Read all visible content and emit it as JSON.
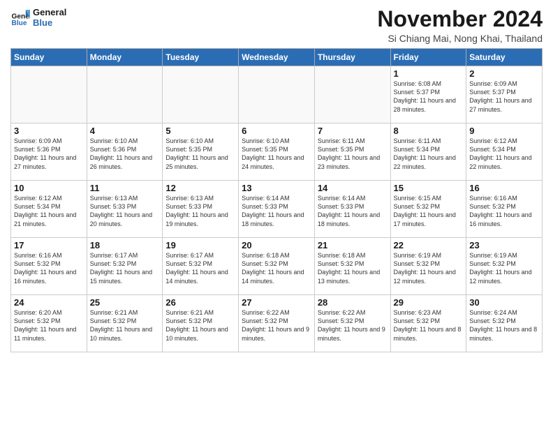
{
  "logo": {
    "line1": "General",
    "line2": "Blue"
  },
  "title": "November 2024",
  "location": "Si Chiang Mai, Nong Khai, Thailand",
  "days_of_week": [
    "Sunday",
    "Monday",
    "Tuesday",
    "Wednesday",
    "Thursday",
    "Friday",
    "Saturday"
  ],
  "weeks": [
    [
      {
        "day": "",
        "detail": ""
      },
      {
        "day": "",
        "detail": ""
      },
      {
        "day": "",
        "detail": ""
      },
      {
        "day": "",
        "detail": ""
      },
      {
        "day": "",
        "detail": ""
      },
      {
        "day": "1",
        "detail": "Sunrise: 6:08 AM\nSunset: 5:37 PM\nDaylight: 11 hours\nand 28 minutes."
      },
      {
        "day": "2",
        "detail": "Sunrise: 6:09 AM\nSunset: 5:37 PM\nDaylight: 11 hours\nand 27 minutes."
      }
    ],
    [
      {
        "day": "3",
        "detail": "Sunrise: 6:09 AM\nSunset: 5:36 PM\nDaylight: 11 hours\nand 27 minutes."
      },
      {
        "day": "4",
        "detail": "Sunrise: 6:10 AM\nSunset: 5:36 PM\nDaylight: 11 hours\nand 26 minutes."
      },
      {
        "day": "5",
        "detail": "Sunrise: 6:10 AM\nSunset: 5:35 PM\nDaylight: 11 hours\nand 25 minutes."
      },
      {
        "day": "6",
        "detail": "Sunrise: 6:10 AM\nSunset: 5:35 PM\nDaylight: 11 hours\nand 24 minutes."
      },
      {
        "day": "7",
        "detail": "Sunrise: 6:11 AM\nSunset: 5:35 PM\nDaylight: 11 hours\nand 23 minutes."
      },
      {
        "day": "8",
        "detail": "Sunrise: 6:11 AM\nSunset: 5:34 PM\nDaylight: 11 hours\nand 22 minutes."
      },
      {
        "day": "9",
        "detail": "Sunrise: 6:12 AM\nSunset: 5:34 PM\nDaylight: 11 hours\nand 22 minutes."
      }
    ],
    [
      {
        "day": "10",
        "detail": "Sunrise: 6:12 AM\nSunset: 5:34 PM\nDaylight: 11 hours\nand 21 minutes."
      },
      {
        "day": "11",
        "detail": "Sunrise: 6:13 AM\nSunset: 5:33 PM\nDaylight: 11 hours\nand 20 minutes."
      },
      {
        "day": "12",
        "detail": "Sunrise: 6:13 AM\nSunset: 5:33 PM\nDaylight: 11 hours\nand 19 minutes."
      },
      {
        "day": "13",
        "detail": "Sunrise: 6:14 AM\nSunset: 5:33 PM\nDaylight: 11 hours\nand 18 minutes."
      },
      {
        "day": "14",
        "detail": "Sunrise: 6:14 AM\nSunset: 5:33 PM\nDaylight: 11 hours\nand 18 minutes."
      },
      {
        "day": "15",
        "detail": "Sunrise: 6:15 AM\nSunset: 5:32 PM\nDaylight: 11 hours\nand 17 minutes."
      },
      {
        "day": "16",
        "detail": "Sunrise: 6:16 AM\nSunset: 5:32 PM\nDaylight: 11 hours\nand 16 minutes."
      }
    ],
    [
      {
        "day": "17",
        "detail": "Sunrise: 6:16 AM\nSunset: 5:32 PM\nDaylight: 11 hours\nand 16 minutes."
      },
      {
        "day": "18",
        "detail": "Sunrise: 6:17 AM\nSunset: 5:32 PM\nDaylight: 11 hours\nand 15 minutes."
      },
      {
        "day": "19",
        "detail": "Sunrise: 6:17 AM\nSunset: 5:32 PM\nDaylight: 11 hours\nand 14 minutes."
      },
      {
        "day": "20",
        "detail": "Sunrise: 6:18 AM\nSunset: 5:32 PM\nDaylight: 11 hours\nand 14 minutes."
      },
      {
        "day": "21",
        "detail": "Sunrise: 6:18 AM\nSunset: 5:32 PM\nDaylight: 11 hours\nand 13 minutes."
      },
      {
        "day": "22",
        "detail": "Sunrise: 6:19 AM\nSunset: 5:32 PM\nDaylight: 11 hours\nand 12 minutes."
      },
      {
        "day": "23",
        "detail": "Sunrise: 6:19 AM\nSunset: 5:32 PM\nDaylight: 11 hours\nand 12 minutes."
      }
    ],
    [
      {
        "day": "24",
        "detail": "Sunrise: 6:20 AM\nSunset: 5:32 PM\nDaylight: 11 hours\nand 11 minutes."
      },
      {
        "day": "25",
        "detail": "Sunrise: 6:21 AM\nSunset: 5:32 PM\nDaylight: 11 hours\nand 10 minutes."
      },
      {
        "day": "26",
        "detail": "Sunrise: 6:21 AM\nSunset: 5:32 PM\nDaylight: 11 hours\nand 10 minutes."
      },
      {
        "day": "27",
        "detail": "Sunrise: 6:22 AM\nSunset: 5:32 PM\nDaylight: 11 hours\nand 9 minutes."
      },
      {
        "day": "28",
        "detail": "Sunrise: 6:22 AM\nSunset: 5:32 PM\nDaylight: 11 hours\nand 9 minutes."
      },
      {
        "day": "29",
        "detail": "Sunrise: 6:23 AM\nSunset: 5:32 PM\nDaylight: 11 hours\nand 8 minutes."
      },
      {
        "day": "30",
        "detail": "Sunrise: 6:24 AM\nSunset: 5:32 PM\nDaylight: 11 hours\nand 8 minutes."
      }
    ]
  ]
}
